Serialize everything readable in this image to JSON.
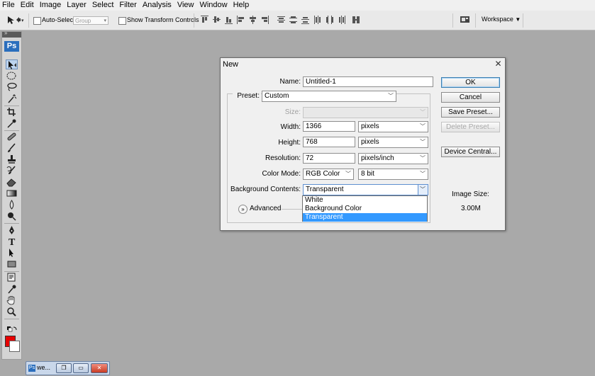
{
  "menubar": {
    "items": [
      "File",
      "Edit",
      "Image",
      "Layer",
      "Select",
      "Filter",
      "Analysis",
      "View",
      "Window",
      "Help"
    ]
  },
  "options_bar": {
    "auto_select_label": "Auto-Select:",
    "auto_select_value": "Group",
    "show_transform_label": "Show Transform Controls",
    "workspace_label": "Workspace"
  },
  "tools": {
    "logo": "Ps"
  },
  "dialog": {
    "title": "New",
    "name_label": "Name:",
    "name_value": "Untitled-1",
    "preset_label": "Preset:",
    "preset_value": "Custom",
    "size_label": "Size:",
    "width_label": "Width:",
    "width_value": "1366",
    "width_unit": "pixels",
    "height_label": "Height:",
    "height_value": "768",
    "height_unit": "pixels",
    "resolution_label": "Resolution:",
    "resolution_value": "72",
    "resolution_unit": "pixels/inch",
    "color_mode_label": "Color Mode:",
    "color_mode_value": "RGB Color",
    "bit_depth_value": "8 bit",
    "bg_contents_label": "Background Contents:",
    "bg_contents_value": "Transparent",
    "bg_options": [
      "White",
      "Background Color",
      "Transparent"
    ],
    "bg_selected_index": 2,
    "advanced_label": "Advanced",
    "buttons": {
      "ok": "OK",
      "cancel": "Cancel",
      "save_preset": "Save Preset...",
      "delete_preset": "Delete Preset...",
      "device_central": "Device Central..."
    },
    "image_size_label": "Image Size:",
    "image_size_value": "3.00M"
  },
  "taskbar": {
    "app_icon_text": "Ps",
    "label": "we..."
  },
  "colors": {
    "foreground": "#e60000",
    "background": "#ffffff",
    "selection": "#3399ff"
  }
}
